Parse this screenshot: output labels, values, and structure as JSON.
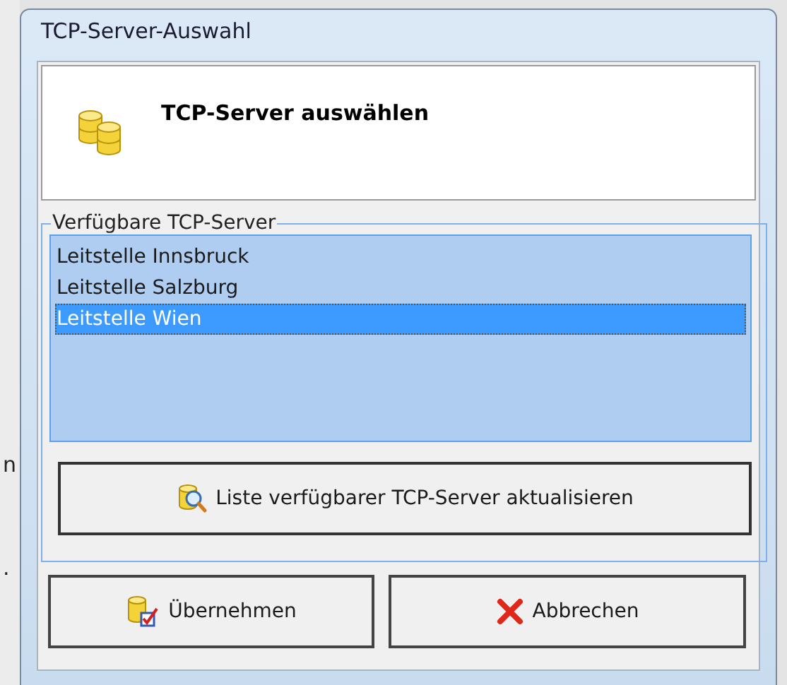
{
  "background_text": [
    "n",
    "."
  ],
  "window": {
    "title": "TCP-Server-Auswahl"
  },
  "header": {
    "title": "TCP-Server auswählen"
  },
  "group": {
    "label": "Verfügbare TCP-Server"
  },
  "servers": [
    {
      "name": "Leitstelle Innsbruck",
      "selected": false
    },
    {
      "name": "Leitstelle Salzburg",
      "selected": false
    },
    {
      "name": "Leitstelle Wien",
      "selected": true
    }
  ],
  "refresh_button": "Liste verfügbarer TCP-Server aktualisieren",
  "buttons": [
    {
      "kind": "accept",
      "label": "Übernehmen"
    },
    {
      "kind": "cancel",
      "label": "Abbrechen"
    }
  ]
}
